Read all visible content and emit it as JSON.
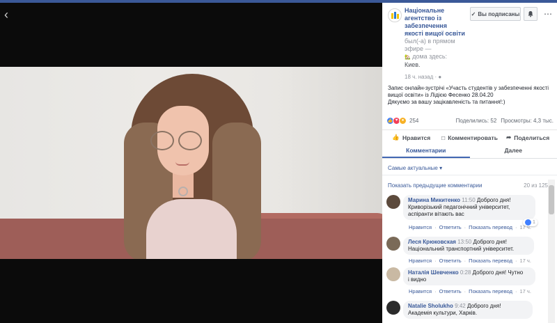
{
  "page": {
    "name": "Національне агентство із забезпечення якості вищої освіти",
    "live_text": "был(-а) в прямом эфире —",
    "location_prefix": "дома здесь:",
    "city": "Киев.",
    "time": "18 ч. назад",
    "subscribe_label": "Вы подписаны"
  },
  "post": {
    "line1": "Запис онлайн-зустрічі «Участь студентів у забезпеченні якості вищої освіти» із Лідією Фесенко 28.04.20",
    "line2": "Дякуємо за вашу зацікавленість та питання!:)"
  },
  "stats": {
    "reactions": "254",
    "shares": "Поделились: 52",
    "views": "Просмотры: 4,3 тыс."
  },
  "actions": {
    "like": "Нравится",
    "comment": "Комментировать",
    "share": "Поделиться"
  },
  "tabs": {
    "comments": "Комментарии",
    "next": "Далее"
  },
  "sort_label": "Самые актуальные ▾",
  "prev_comments": {
    "label": "Показать предыдущие комментарии",
    "count": "20 из 125"
  },
  "comments": [
    {
      "author": "Марина Микитенко",
      "time": "11:50",
      "text1": "Доброго дня!",
      "text2": "Криворізький педагонічний університет,",
      "text3": "аспіранти вітають вас",
      "likes": "1",
      "like": "Нравится",
      "reply": "Ответить",
      "translate": "Показать перевод",
      "age": "17 ч."
    },
    {
      "author": "Леся Крюковская",
      "time": "13:50",
      "text1": "Доброго дня!",
      "text2": "Національний транспортний університет.",
      "text3": "",
      "like": "Нравится",
      "reply": "Ответить",
      "translate": "Показать перевод",
      "age": "17 ч."
    },
    {
      "author": "Наталія Шевченко",
      "time": "0:28",
      "text1": "Доброго дня! Чутно",
      "text2": "і видно",
      "text3": "",
      "like": "Нравится",
      "reply": "Ответить",
      "translate": "Показать перевод",
      "age": "17 ч."
    },
    {
      "author": "Natalie Sholukho",
      "time": "9:42",
      "text1": "Доброго дня!",
      "text2": "Академія культури, Харків.",
      "text3": "",
      "like": "",
      "reply": "",
      "translate": "",
      "age": ""
    }
  ],
  "colors": {
    "brand": "#3b5998",
    "link": "#385898",
    "bubble": "#f2f3f5"
  }
}
